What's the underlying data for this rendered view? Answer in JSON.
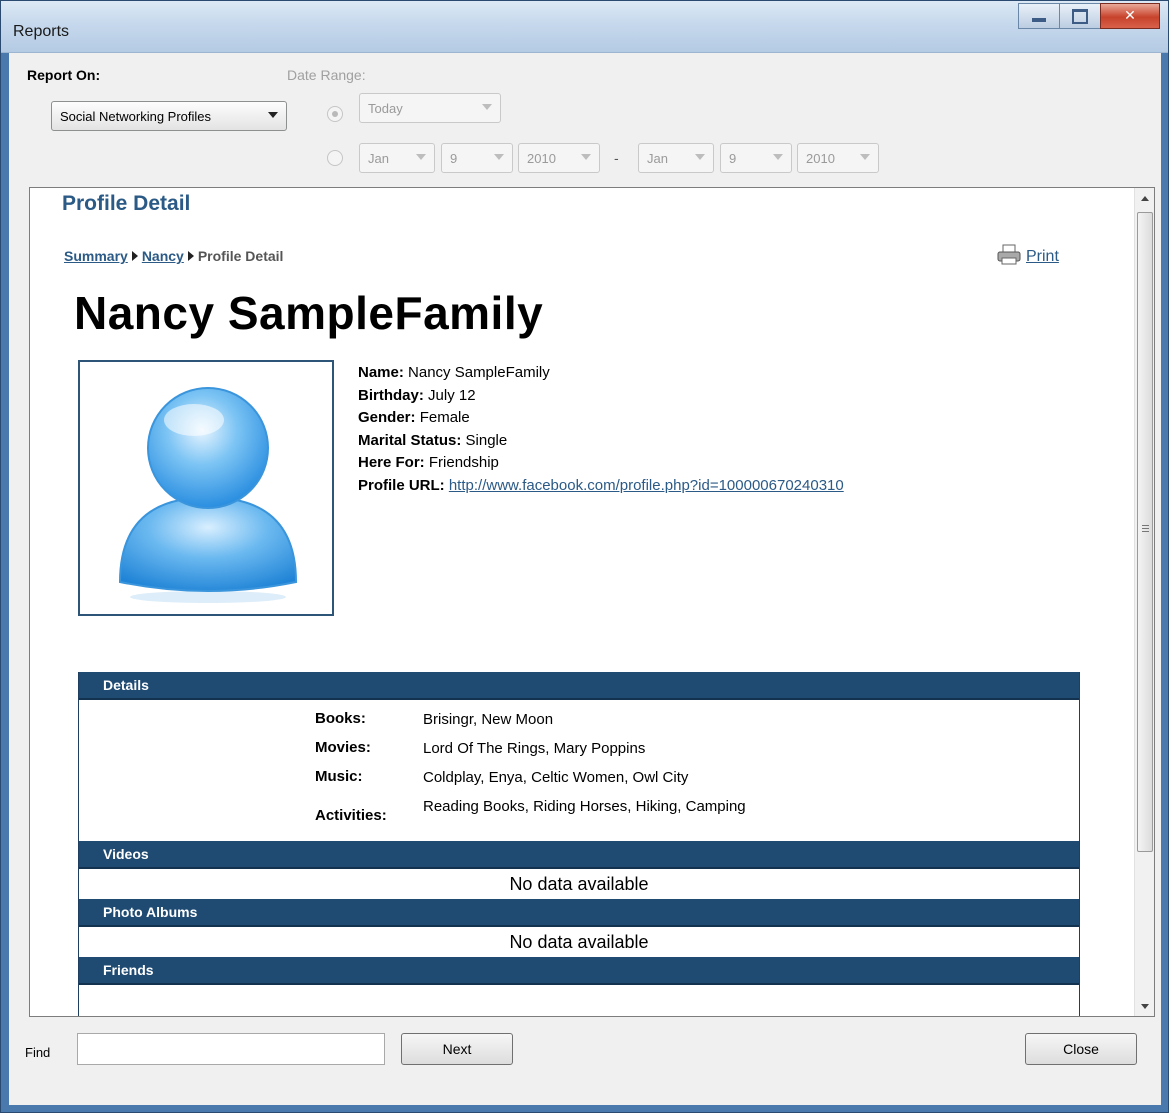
{
  "window": {
    "title": "Reports"
  },
  "controls": {
    "report_on_label": "Report On:",
    "report_on_value": "Social Networking Profiles",
    "date_range_label": "Date Range:",
    "preset_value": "Today",
    "from": {
      "month": "Jan",
      "day": "9",
      "year": "2010"
    },
    "separator": "-",
    "to": {
      "month": "Jan",
      "day": "9",
      "year": "2010"
    }
  },
  "report": {
    "heading": "Profile Detail",
    "breadcrumb": [
      "Summary",
      "Nancy",
      "Profile Detail"
    ],
    "print_label": "Print",
    "name": "Nancy SampleFamily",
    "fields": [
      {
        "label": "Name:",
        "value": "Nancy SampleFamily"
      },
      {
        "label": "Birthday:",
        "value": "July 12"
      },
      {
        "label": "Gender:",
        "value": "Female"
      },
      {
        "label": "Marital Status:",
        "value": "Single"
      },
      {
        "label": "Here For:",
        "value": "Friendship"
      },
      {
        "label": "Profile URL:",
        "value": "http://www.facebook.com/profile.php?id=100000670240310"
      }
    ],
    "sections": {
      "details": {
        "title": "Details",
        "rows": [
          {
            "label": "Books:",
            "value": "Brisingr, New Moon"
          },
          {
            "label": "Movies:",
            "value": "Lord Of The Rings, Mary Poppins"
          },
          {
            "label": "Music:",
            "value": "Coldplay, Enya, Celtic Women, Owl City"
          },
          {
            "label": "Activities:",
            "value": "Reading Books, Riding Horses, Hiking, Camping"
          }
        ]
      },
      "videos": {
        "title": "Videos",
        "empty": "No data available"
      },
      "photo_albums": {
        "title": "Photo Albums",
        "empty": "No data available"
      },
      "friends": {
        "title": "Friends"
      }
    }
  },
  "footer": {
    "find_label": "Find",
    "find_value": "",
    "next_label": "Next",
    "close_label": "Close"
  },
  "colors": {
    "accent": "#1f4b73",
    "link": "#2b5a86"
  },
  "icons": [
    "minimize-icon",
    "maximize-icon",
    "close-icon",
    "chevron-down-icon",
    "printer-icon",
    "user-avatar-icon"
  ]
}
